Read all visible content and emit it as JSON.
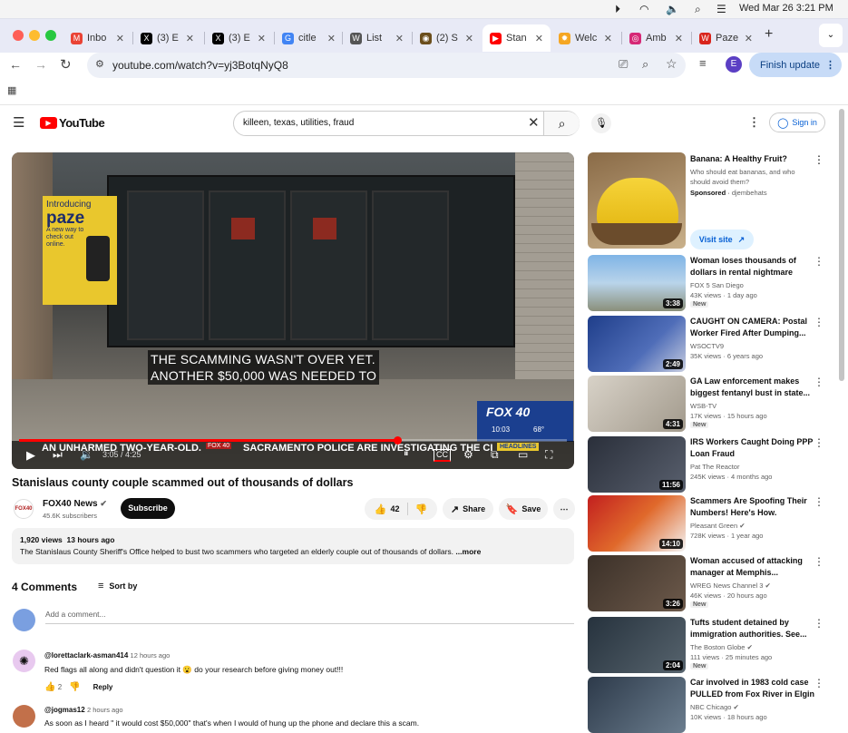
{
  "menubar": {
    "date_time": "Wed Mar 26  3:21 PM"
  },
  "tabs": [
    {
      "label": "Inbo",
      "icon": "gmail-icon",
      "color": "#ea4335",
      "glyph": "M"
    },
    {
      "label": "(3) E",
      "icon": "x-icon",
      "color": "#000000",
      "glyph": "X"
    },
    {
      "label": "(3) E",
      "icon": "x-icon",
      "color": "#000000",
      "glyph": "X"
    },
    {
      "label": "citle",
      "icon": "google-icon",
      "color": "#4285f4",
      "glyph": "G"
    },
    {
      "label": "List",
      "icon": "wikipedia-icon",
      "color": "#555555",
      "glyph": "W"
    },
    {
      "label": "(2) S",
      "icon": "site-icon",
      "color": "#6b4e1c",
      "glyph": "◉"
    },
    {
      "label": "Stan",
      "icon": "youtube-icon",
      "color": "#ff0000",
      "glyph": "▶"
    },
    {
      "label": "Welc",
      "icon": "sun-icon",
      "color": "#f5a623",
      "glyph": "✹"
    },
    {
      "label": "Amb",
      "icon": "instagram-icon",
      "color": "#d62976",
      "glyph": "◎"
    },
    {
      "label": "Paze",
      "icon": "paze-icon",
      "color": "#d9251c",
      "glyph": "W"
    }
  ],
  "address": {
    "url": "youtube.com/watch?v=yj3BotqNyQ8",
    "profile_letter": "E",
    "update_label": "Finish update"
  },
  "youtube": {
    "logo_text": "YouTube",
    "search_value": "killeen, texas, utilities, fraud",
    "sign_in": "Sign in",
    "video": {
      "caption_line1": "THE SCAMMING WASN'T OVER YET.",
      "caption_line2": "ANOTHER $50,000 WAS NEEDED TO",
      "ticker_left": "AN UNHARMED TWO-YEAR-OLD.",
      "ticker_right": "SACRAMENTO POLICE ARE INVESTIGATING THE CIRCL",
      "station": "FOX 40",
      "clock": "10:03",
      "temp": "68°",
      "headlines": "HEADLINES",
      "time_display": "3:05 / 4:25",
      "sign_introducing": "Introducing",
      "sign_brand": "paze",
      "sign_small": "A new way to check out online.",
      "progress": 0.69
    },
    "title": "Stanislaus county couple scammed out of thousands of dollars",
    "channel": {
      "name": "FOX40 News",
      "subs": "45.6K subscribers",
      "subscribe": "Subscribe",
      "avatar": "FOX40"
    },
    "actions": {
      "likes": "42",
      "share": "Share",
      "save": "Save"
    },
    "description": {
      "views": "1,920 views",
      "age": "13 hours ago",
      "text": "The Stanislaus County Sheriff's Office helped to bust two scammers who targeted an elderly couple out of thousands of dollars.",
      "more": "...more"
    },
    "comments": {
      "count_label": "4 Comments",
      "sort_label": "Sort by",
      "add_placeholder": "Add a comment...",
      "items": [
        {
          "author": "@lorettaclark-asman414",
          "time": "12 hours ago",
          "text": "Red flags all along and didn't question it 😮 do your research before giving money out!!!",
          "likes": "2",
          "reply": "Reply"
        },
        {
          "author": "@jogmas12",
          "time": "2 hours ago",
          "text": "As soon as I heard \" it would cost $50,000\" that's when I would of hung up the phone and declare this a scam.",
          "likes": "",
          "reply": ""
        }
      ]
    },
    "ad": {
      "title": "Banana: A Healthy Fruit?",
      "desc": "Who should eat bananas, and who should avoid them?",
      "sponsored": "Sponsored",
      "sponsor": "djembehats",
      "visit": "Visit site"
    },
    "sidebar": [
      {
        "title": "Woman loses thousands of dollars in rental nightmare",
        "channel": "FOX 5 San Diego",
        "views": "43K views",
        "age": "1 day ago",
        "duration": "3:38",
        "badge": "New",
        "verified": false
      },
      {
        "title": "CAUGHT ON CAMERA: Postal Worker Fired After Dumping...",
        "channel": "WSOCTV9",
        "views": "35K views",
        "age": "6 years ago",
        "duration": "2:49",
        "badge": "",
        "verified": false
      },
      {
        "title": "GA Law enforcement makes biggest fentanyl bust in state...",
        "channel": "WSB-TV",
        "views": "17K views",
        "age": "15 hours ago",
        "duration": "4:31",
        "badge": "New",
        "verified": false
      },
      {
        "title": "IRS Workers Caught Doing PPP Loan Fraud",
        "channel": "Pat The Reactor",
        "views": "245K views",
        "age": "4 months ago",
        "duration": "11:56",
        "badge": "",
        "verified": false
      },
      {
        "title": "Scammers Are Spoofing Their Numbers! Here's How.",
        "channel": "Pleasant Green",
        "views": "728K views",
        "age": "1 year ago",
        "duration": "14:10",
        "badge": "",
        "verified": true
      },
      {
        "title": "Woman accused of attacking manager at Memphis...",
        "channel": "WREG News Channel 3",
        "views": "46K views",
        "age": "20 hours ago",
        "duration": "3:26",
        "badge": "New",
        "verified": true
      },
      {
        "title": "Tufts student detained by immigration authorities. See...",
        "channel": "The Boston Globe",
        "views": "111 views",
        "age": "25 minutes ago",
        "duration": "2:04",
        "badge": "New",
        "verified": true
      },
      {
        "title": "Car involved in 1983 cold case PULLED from Fox River in Elgin",
        "channel": "NBC Chicago",
        "views": "10K views",
        "age": "18 hours ago",
        "duration": "",
        "badge": "",
        "verified": true
      }
    ]
  }
}
